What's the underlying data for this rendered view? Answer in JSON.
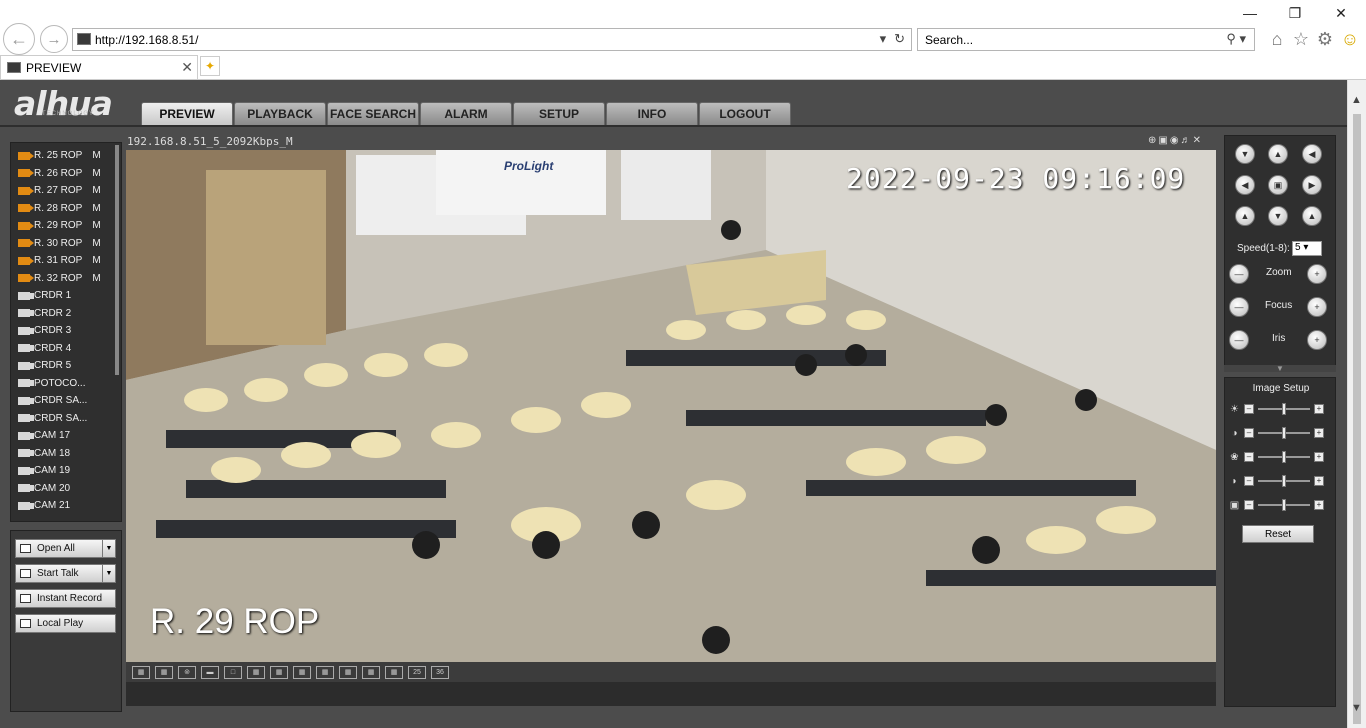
{
  "browser": {
    "url": "http://192.168.8.51/",
    "search_placeholder": "Search...",
    "tab_title": "PREVIEW"
  },
  "app": {
    "logo": "alhua",
    "logo_sub": "TECHNOLOGY",
    "menu": [
      "PREVIEW",
      "PLAYBACK",
      "FACE SEARCH",
      "ALARM",
      "SETUP",
      "INFO",
      "LOGOUT"
    ],
    "active_menu": "PREVIEW"
  },
  "cameras": [
    {
      "name": "R. 25 ROP",
      "stream": "M",
      "active": true
    },
    {
      "name": "R. 26 ROP",
      "stream": "M",
      "active": true
    },
    {
      "name": "R. 27 ROP",
      "stream": "M",
      "active": true
    },
    {
      "name": "R. 28 ROP",
      "stream": "M",
      "active": true
    },
    {
      "name": "R. 29 ROP",
      "stream": "M",
      "active": true
    },
    {
      "name": "R. 30 ROP",
      "stream": "M",
      "active": true
    },
    {
      "name": "R. 31 ROP",
      "stream": "M",
      "active": true
    },
    {
      "name": "R. 32 ROP",
      "stream": "M",
      "active": true
    },
    {
      "name": "CRDR 1",
      "stream": "",
      "active": false
    },
    {
      "name": "CRDR 2",
      "stream": "",
      "active": false
    },
    {
      "name": "CRDR 3",
      "stream": "",
      "active": false
    },
    {
      "name": "CRDR 4",
      "stream": "",
      "active": false
    },
    {
      "name": "CRDR 5",
      "stream": "",
      "active": false
    },
    {
      "name": "POTOCO...",
      "stream": "",
      "active": false
    },
    {
      "name": "CRDR SA...",
      "stream": "",
      "active": false
    },
    {
      "name": "CRDR SA...",
      "stream": "",
      "active": false
    },
    {
      "name": "CAM 17",
      "stream": "",
      "active": false
    },
    {
      "name": "CAM 18",
      "stream": "",
      "active": false
    },
    {
      "name": "CAM 19",
      "stream": "",
      "active": false
    },
    {
      "name": "CAM 20",
      "stream": "",
      "active": false
    },
    {
      "name": "CAM 21",
      "stream": "",
      "active": false
    }
  ],
  "actions": {
    "open_all": "Open All",
    "start_talk": "Start Talk",
    "instant_record": "Instant Record",
    "local_play": "Local Play"
  },
  "video": {
    "stream_title": "192.168.8.51_5_2092Kbps_M",
    "timestamp": "2022-09-23 09:16:09",
    "channel_label": "R. 29 ROP",
    "projector_brand": "ProLight"
  },
  "layouts": [
    "",
    "",
    "",
    "",
    "",
    "",
    "",
    "",
    "",
    "",
    "",
    "",
    "25",
    "36"
  ],
  "ptz": {
    "speed_label": "Speed(1-8):",
    "speed_value": "5",
    "zoom": "Zoom",
    "focus": "Focus",
    "iris": "Iris"
  },
  "image_setup": {
    "title": "Image Setup",
    "reset": "Reset",
    "sliders": [
      {
        "icon": "brightness-icon",
        "value": 0.5
      },
      {
        "icon": "contrast-icon",
        "value": 0.5
      },
      {
        "icon": "saturation-icon",
        "value": 0.5
      },
      {
        "icon": "hue-icon",
        "value": 0.5
      },
      {
        "icon": "gamma-icon",
        "value": 0.5
      }
    ]
  },
  "colors": {
    "app_bg": "#4c4c4c",
    "panel_bg": "#2f2f2f",
    "cam_active": "#e28b13"
  }
}
